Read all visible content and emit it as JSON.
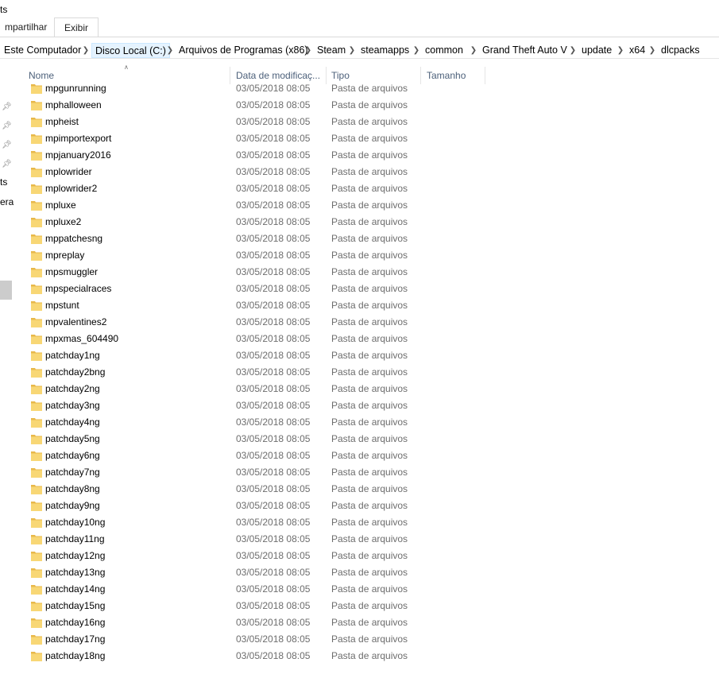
{
  "window": {
    "title_fragment": "ts"
  },
  "ribbon": {
    "tabs": [
      {
        "label": "mpartilhar",
        "active": false
      },
      {
        "label": "Exibir",
        "active": true
      }
    ]
  },
  "address": {
    "crumbs": [
      "Este Computador",
      "Disco Local (C:)",
      "Arquivos de Programas (x86)",
      "Steam",
      "steamapps",
      "common",
      "Grand Theft Auto V",
      "update",
      "x64",
      "dlcpacks"
    ],
    "highlighted_index": 1
  },
  "navpane": {
    "fragments": [
      "ts",
      "era"
    ]
  },
  "columns": {
    "name": "Nome",
    "date": "Data de modificaç...",
    "type": "Tipo",
    "size": "Tamanho",
    "sorted_by": "name"
  },
  "colors": {
    "folder": "#f8d775",
    "folder_dark": "#e8b84a",
    "header_text": "#4c607a",
    "selection": "#cccccc"
  },
  "files": [
    {
      "name": "mpgunrunning",
      "date": "03/05/2018 08:05",
      "type": "Pasta de arquivos",
      "icon": "folder-icon"
    },
    {
      "name": "mphalloween",
      "date": "03/05/2018 08:05",
      "type": "Pasta de arquivos",
      "icon": "folder-icon"
    },
    {
      "name": "mpheist",
      "date": "03/05/2018 08:05",
      "type": "Pasta de arquivos",
      "icon": "folder-icon"
    },
    {
      "name": "mpimportexport",
      "date": "03/05/2018 08:05",
      "type": "Pasta de arquivos",
      "icon": "folder-icon"
    },
    {
      "name": "mpjanuary2016",
      "date": "03/05/2018 08:05",
      "type": "Pasta de arquivos",
      "icon": "folder-icon"
    },
    {
      "name": "mplowrider",
      "date": "03/05/2018 08:05",
      "type": "Pasta de arquivos",
      "icon": "folder-icon"
    },
    {
      "name": "mplowrider2",
      "date": "03/05/2018 08:05",
      "type": "Pasta de arquivos",
      "icon": "folder-icon"
    },
    {
      "name": "mpluxe",
      "date": "03/05/2018 08:05",
      "type": "Pasta de arquivos",
      "icon": "folder-icon"
    },
    {
      "name": "mpluxe2",
      "date": "03/05/2018 08:05",
      "type": "Pasta de arquivos",
      "icon": "folder-icon"
    },
    {
      "name": "mppatchesng",
      "date": "03/05/2018 08:05",
      "type": "Pasta de arquivos",
      "icon": "folder-icon"
    },
    {
      "name": "mpreplay",
      "date": "03/05/2018 08:05",
      "type": "Pasta de arquivos",
      "icon": "folder-icon"
    },
    {
      "name": "mpsmuggler",
      "date": "03/05/2018 08:05",
      "type": "Pasta de arquivos",
      "icon": "folder-icon"
    },
    {
      "name": "mpspecialraces",
      "date": "03/05/2018 08:05",
      "type": "Pasta de arquivos",
      "icon": "folder-icon"
    },
    {
      "name": "mpstunt",
      "date": "03/05/2018 08:05",
      "type": "Pasta de arquivos",
      "icon": "folder-icon"
    },
    {
      "name": "mpvalentines2",
      "date": "03/05/2018 08:05",
      "type": "Pasta de arquivos",
      "icon": "folder-icon"
    },
    {
      "name": "mpxmas_604490",
      "date": "03/05/2018 08:05",
      "type": "Pasta de arquivos",
      "icon": "folder-icon"
    },
    {
      "name": "patchday1ng",
      "date": "03/05/2018 08:05",
      "type": "Pasta de arquivos",
      "icon": "folder-icon"
    },
    {
      "name": "patchday2bng",
      "date": "03/05/2018 08:05",
      "type": "Pasta de arquivos",
      "icon": "folder-icon"
    },
    {
      "name": "patchday2ng",
      "date": "03/05/2018 08:05",
      "type": "Pasta de arquivos",
      "icon": "folder-icon"
    },
    {
      "name": "patchday3ng",
      "date": "03/05/2018 08:05",
      "type": "Pasta de arquivos",
      "icon": "folder-icon"
    },
    {
      "name": "patchday4ng",
      "date": "03/05/2018 08:05",
      "type": "Pasta de arquivos",
      "icon": "folder-icon"
    },
    {
      "name": "patchday5ng",
      "date": "03/05/2018 08:05",
      "type": "Pasta de arquivos",
      "icon": "folder-icon"
    },
    {
      "name": "patchday6ng",
      "date": "03/05/2018 08:05",
      "type": "Pasta de arquivos",
      "icon": "folder-icon"
    },
    {
      "name": "patchday7ng",
      "date": "03/05/2018 08:05",
      "type": "Pasta de arquivos",
      "icon": "folder-icon"
    },
    {
      "name": "patchday8ng",
      "date": "03/05/2018 08:05",
      "type": "Pasta de arquivos",
      "icon": "folder-icon"
    },
    {
      "name": "patchday9ng",
      "date": "03/05/2018 08:05",
      "type": "Pasta de arquivos",
      "icon": "folder-icon"
    },
    {
      "name": "patchday10ng",
      "date": "03/05/2018 08:05",
      "type": "Pasta de arquivos",
      "icon": "folder-icon"
    },
    {
      "name": "patchday11ng",
      "date": "03/05/2018 08:05",
      "type": "Pasta de arquivos",
      "icon": "folder-icon"
    },
    {
      "name": "patchday12ng",
      "date": "03/05/2018 08:05",
      "type": "Pasta de arquivos",
      "icon": "folder-icon"
    },
    {
      "name": "patchday13ng",
      "date": "03/05/2018 08:05",
      "type": "Pasta de arquivos",
      "icon": "folder-icon"
    },
    {
      "name": "patchday14ng",
      "date": "03/05/2018 08:05",
      "type": "Pasta de arquivos",
      "icon": "folder-icon"
    },
    {
      "name": "patchday15ng",
      "date": "03/05/2018 08:05",
      "type": "Pasta de arquivos",
      "icon": "folder-icon"
    },
    {
      "name": "patchday16ng",
      "date": "03/05/2018 08:05",
      "type": "Pasta de arquivos",
      "icon": "folder-icon"
    },
    {
      "name": "patchday17ng",
      "date": "03/05/2018 08:05",
      "type": "Pasta de arquivos",
      "icon": "folder-icon"
    },
    {
      "name": "patchday18ng",
      "date": "03/05/2018 08:05",
      "type": "Pasta de arquivos",
      "icon": "folder-icon"
    }
  ]
}
